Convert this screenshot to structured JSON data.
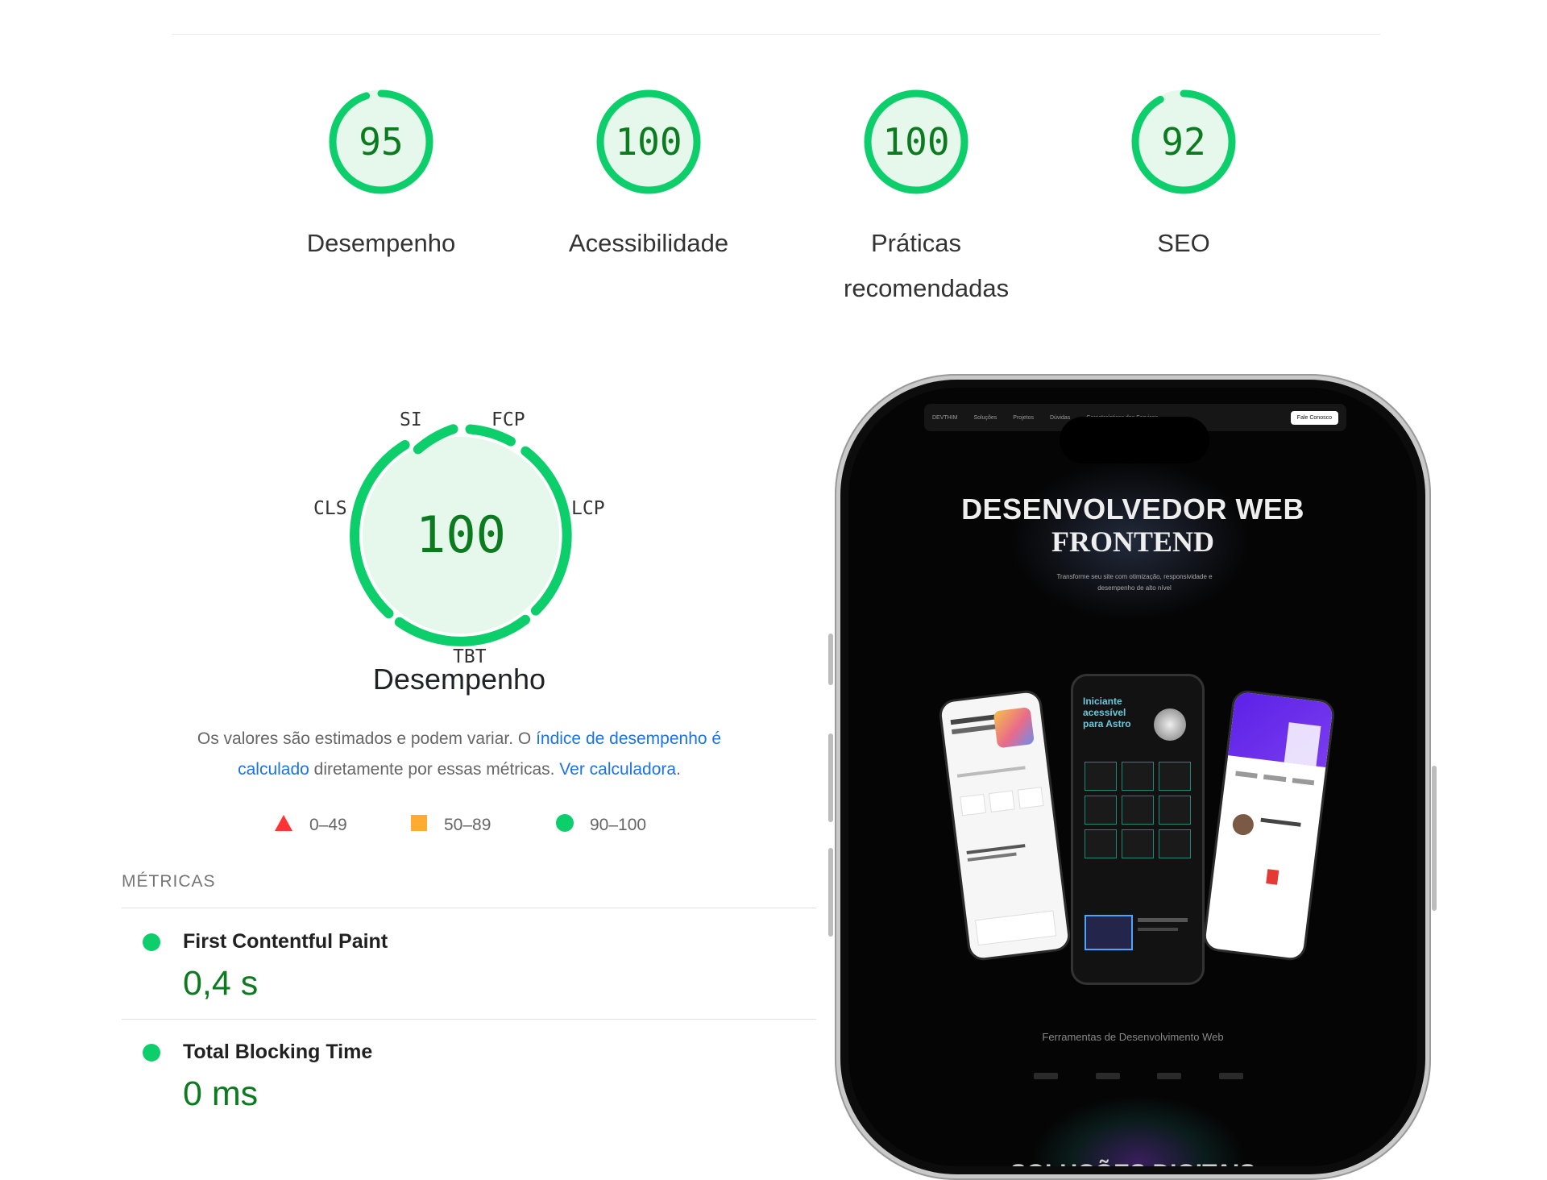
{
  "scores": [
    {
      "value": "95",
      "label": "Desempenho",
      "fraction": 0.95
    },
    {
      "value": "100",
      "label": "Acessibilidade",
      "fraction": 1.0
    },
    {
      "value": "100",
      "label": "Práticas recomendadas",
      "fraction": 1.0
    },
    {
      "value": "92",
      "label": "SEO",
      "fraction": 0.92
    }
  ],
  "performance": {
    "score": "100",
    "title": "Desempenho",
    "metric_labels": {
      "si": "SI",
      "fcp": "FCP",
      "lcp": "LCP",
      "tbt": "TBT",
      "cls": "CLS"
    }
  },
  "description": {
    "part1": "Os valores são estimados e podem variar. O ",
    "link1": "índice de desempenho é calculado",
    "part2": " diretamente por essas métricas. ",
    "link2": "Ver calculadora",
    "part3": "."
  },
  "legend": [
    {
      "range": "0–49",
      "color": "#ff3333",
      "shape": "triangle"
    },
    {
      "range": "50–89",
      "color": "#ffaa33",
      "shape": "square"
    },
    {
      "range": "90–100",
      "color": "#0cce6b",
      "shape": "circle"
    }
  ],
  "metrics": {
    "heading": "MÉTRICAS",
    "items": [
      {
        "name": "First Contentful Paint",
        "value": "0,4 s"
      },
      {
        "name": "Total Blocking Time",
        "value": "0 ms"
      }
    ]
  },
  "colors": {
    "pass_green": "#0cce6b",
    "pass_text": "#0c7a1f",
    "pass_fill": "#e6f7ec"
  },
  "phone_screen": {
    "nav_items": [
      "DEVTHIM",
      "Soluções",
      "Projetos",
      "Dúvidas",
      "Características dos Serviços"
    ],
    "nav_cta": "Fale Conosco",
    "hero_line1": "DESENVOLVEDOR WEB",
    "hero_line2": "FRONTEND",
    "hero_subtitle": "Transforme seu site com otimização, responsividade e desempenho de alto nível",
    "center_phone_heading": "Iniciante acessível para Astro",
    "tools_label": "Ferramentas de Desenvolvimento Web",
    "bottom_heading": "SOLUÇÕES DIGITAIS"
  }
}
